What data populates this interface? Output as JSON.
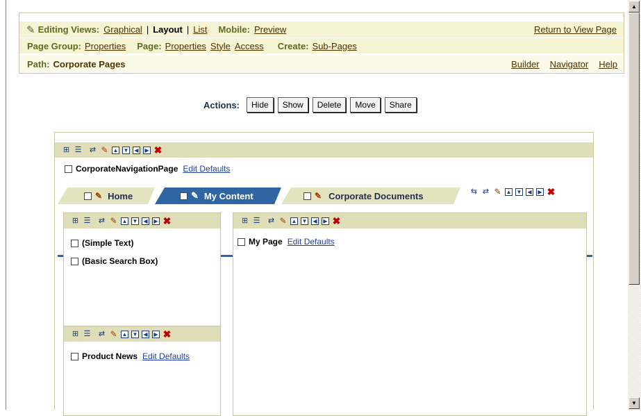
{
  "header": {
    "editing_views_label": "Editing Views:",
    "graphical": "Graphical",
    "layout": "Layout",
    "list": "List",
    "mobile_label": "Mobile:",
    "preview": "Preview",
    "return": "Return to View Page",
    "page_group_label": "Page Group:",
    "page_group_properties": "Properties",
    "page_label": "Page:",
    "page_properties": "Properties",
    "style": "Style",
    "access": "Access",
    "create_label": "Create:",
    "sub_pages": "Sub-Pages",
    "path_label": "Path:",
    "path_value": "Corporate Pages",
    "builder": "Builder",
    "navigator": "Navigator",
    "help": "Help"
  },
  "actions": {
    "label": "Actions:",
    "buttons": [
      "Hide",
      "Show",
      "Delete",
      "Move",
      "Share"
    ]
  },
  "region": {
    "nav_page": "CorporateNavigationPage",
    "edit_defaults": "Edit Defaults"
  },
  "tabs": [
    "Home",
    "My Content",
    "Corporate Documents"
  ],
  "left_top": {
    "items": [
      "(Simple Text)",
      "(Basic Search Box)"
    ]
  },
  "left_bottom": {
    "item": "Product News",
    "edit_defaults": "Edit Defaults"
  },
  "right": {
    "item": "My Page",
    "edit_defaults": "Edit Defaults"
  },
  "icons": {
    "pencil": "pencil-icon",
    "delete": "delete-icon",
    "add_portlet": "add-portlet-icon",
    "add_item": "add-item-icon",
    "move_up": "move-up-icon",
    "move_down": "move-down-icon",
    "move_left": "move-left-icon",
    "move_right": "move-right-icon"
  }
}
